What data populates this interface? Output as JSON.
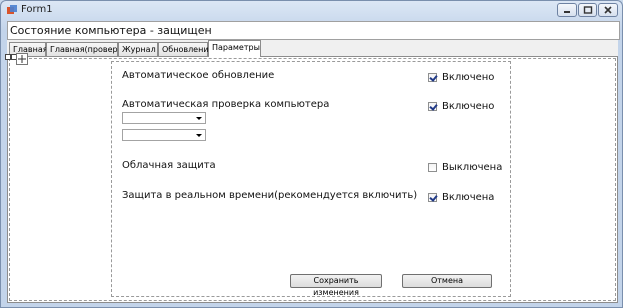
{
  "window": {
    "title": "Form1"
  },
  "status": {
    "text": "Состояние компьютера - защищен"
  },
  "tabs": [
    {
      "label": "Главная"
    },
    {
      "label": "Главная(проверка)"
    },
    {
      "label": "Журнал"
    },
    {
      "label": "Обновления"
    },
    {
      "label": "Параметры"
    }
  ],
  "active_tab": "Параметры",
  "settings": {
    "auto_update": {
      "label": "Автоматическое обновление",
      "state": "Включено",
      "checked": true
    },
    "auto_scan": {
      "label": "Автоматическая проверка компьютера",
      "state": "Включено",
      "checked": true,
      "combo1": "",
      "combo2": ""
    },
    "cloud": {
      "label": "Облачная защита",
      "state": "Выключена",
      "checked": false
    },
    "realtime": {
      "label": "Защита в реальном времени(рекомендуется включить)",
      "state": "Включена",
      "checked": true
    }
  },
  "buttons": {
    "save": "Сохранить изменения",
    "cancel": "Отмена"
  }
}
